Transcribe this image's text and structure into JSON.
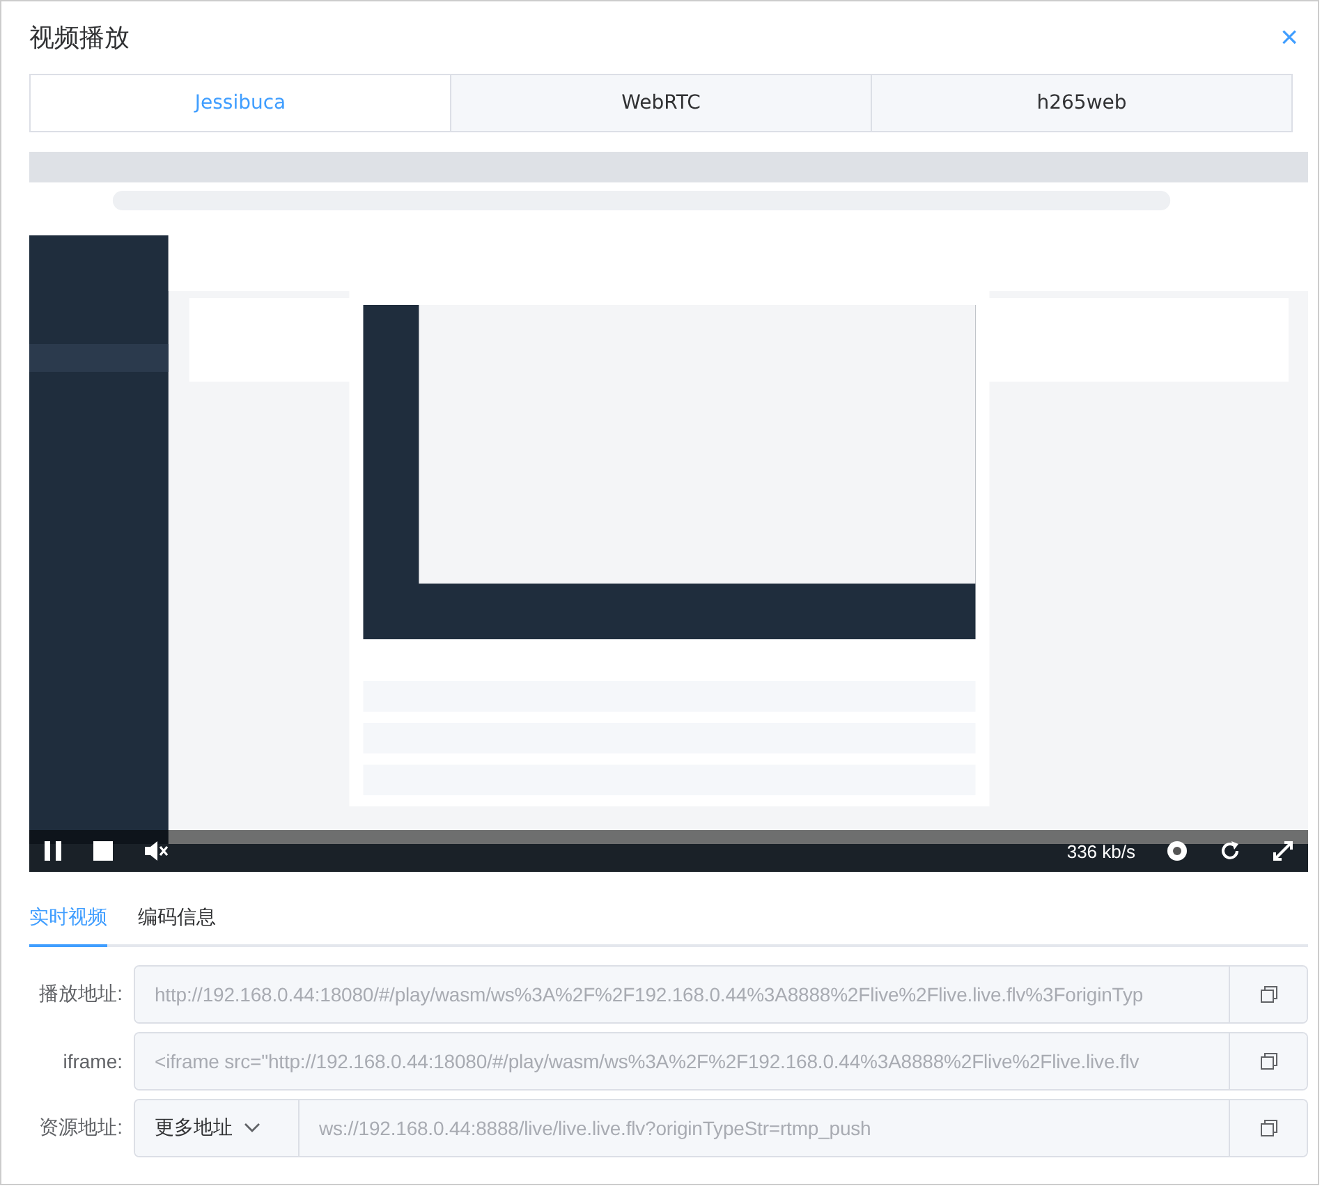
{
  "dialog": {
    "title": "视频播放",
    "close": "×"
  },
  "player_tabs": [
    {
      "label": "Jessibuca",
      "selected": true
    },
    {
      "label": "WebRTC",
      "selected": false
    },
    {
      "label": "h265web",
      "selected": false
    }
  ],
  "video": {
    "controls": {
      "playing": true,
      "muted": true,
      "bitrate": "336 kb/s"
    }
  },
  "info_tabs": [
    {
      "label": "实时视频",
      "selected": true
    },
    {
      "label": "编码信息",
      "selected": false
    }
  ],
  "fields": [
    {
      "kind": "plain",
      "label": "播放地址:",
      "value": "http://192.168.0.44:18080/#/play/wasm/ws%3A%2F%2F192.168.0.44%3A8888%2Flive%2Flive.live.flv%3ForiginTyp"
    },
    {
      "kind": "plain",
      "label": "iframe:",
      "value": "<iframe src=\"http://192.168.0.44:18080/#/play/wasm/ws%3A%2F%2F192.168.0.44%3A8888%2Flive%2Flive.live.flv"
    },
    {
      "kind": "select",
      "label": "资源地址:",
      "select": "更多地址",
      "value": "ws://192.168.0.44:8888/live/live.live.flv?originTypeStr=rtmp_push"
    }
  ]
}
